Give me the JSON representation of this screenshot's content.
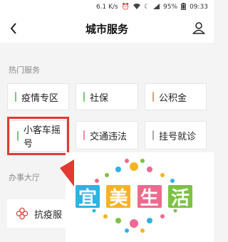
{
  "status_bar": {
    "network_speed": "6.1 K/s",
    "battery": "95%",
    "time": "09:33"
  },
  "nav": {
    "title": "城市服务"
  },
  "hot_services": {
    "label": "热门服务",
    "items": [
      {
        "label": "疫情专区",
        "accent": "#7bc67b"
      },
      {
        "label": "社保",
        "accent": "#7bc67b"
      },
      {
        "label": "公积金",
        "accent": "#d9a66a"
      },
      {
        "label": "小客车摇号",
        "accent": "#7bc67b"
      },
      {
        "label": "交通违法",
        "accent": "#e88ba6"
      },
      {
        "label": "挂号就诊",
        "accent": "#aaaaaa"
      }
    ]
  },
  "office_hall": {
    "label": "办事大厅",
    "card_label": "抗疫服"
  },
  "overlay_logo": {
    "chars": [
      "宜",
      "美",
      "生",
      "活"
    ],
    "colors": [
      "#2fb3e0",
      "#f5b324",
      "#ee6a8f",
      "#7cc242"
    ]
  },
  "colors": {
    "highlight": "#e23a32"
  }
}
